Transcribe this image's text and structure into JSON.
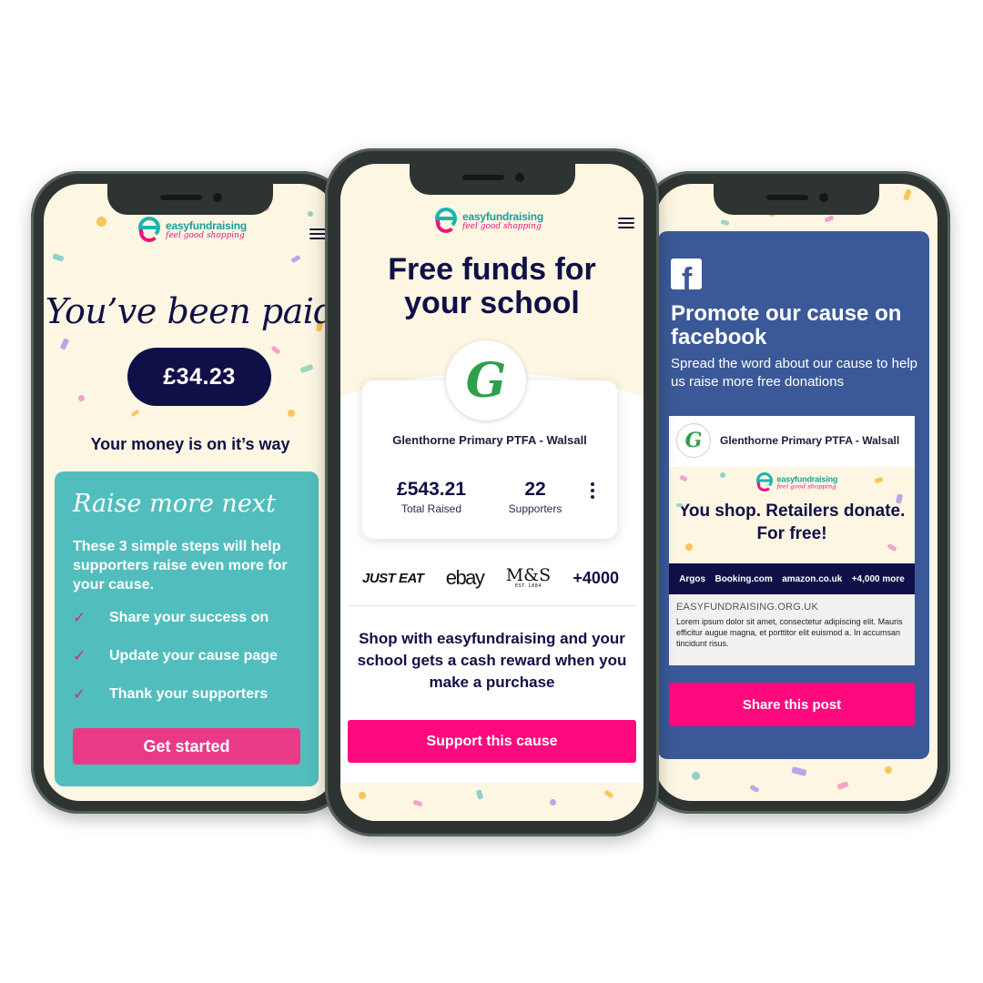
{
  "brand": {
    "name": "easyfundraising",
    "tagline": "feel good shopping",
    "pink": "#ff0a7e",
    "navy": "#101048",
    "teal": "#52bdbd",
    "facebook_blue": "#3b5998"
  },
  "left_phone": {
    "title": "You’ve been paid",
    "amount": "£34.23",
    "status": "Your money is on it’s way",
    "card": {
      "title": "Raise more next",
      "description": "These 3 simple steps will help supporters raise even more for your cause.",
      "steps": [
        {
          "label": "Share your success on"
        },
        {
          "label": "Update your cause page"
        },
        {
          "label": "Thank your supporters"
        }
      ],
      "button": "Get started"
    }
  },
  "center_phone": {
    "title_line1": "Free funds for",
    "title_line2": "your school",
    "cause": {
      "name": "Glenthorne Primary PTFA - Walsall",
      "total_raised": "£543.21",
      "total_raised_label": "Total Raised",
      "supporters": "22",
      "supporters_label": "Supporters"
    },
    "retailers": {
      "justeat": "JUST EAT",
      "ebay": "ebay",
      "ms": "M&S",
      "ms_sub": "EST. 1884",
      "more": "+4000"
    },
    "description": "Shop with easyfundraising and your school gets a cash reward when you make a purchase",
    "button": "Support this cause"
  },
  "right_phone": {
    "fb_glyph": "f",
    "title": "Promote our cause on facebook",
    "subtitle": "Spread the word about our cause to help us raise more free donations",
    "post": {
      "author": "Glenthorne Primary PTFA - Walsall",
      "banner_text": "You shop. Retailers donate. For free!",
      "strip": {
        "r1": "Argos",
        "r2": "Booking.com",
        "r3": "amazon.co.uk",
        "more": "+4,000 more"
      },
      "domain": "EASYFUNDRAISING.ORG.UK",
      "body": "Lorem ipsum dolor sit amet, consectetur adipiscing elit. Mauris efficitur augue magna, et porttitor elit euismod a. In accumsan tincidunt risus."
    },
    "button": "Share this post"
  }
}
